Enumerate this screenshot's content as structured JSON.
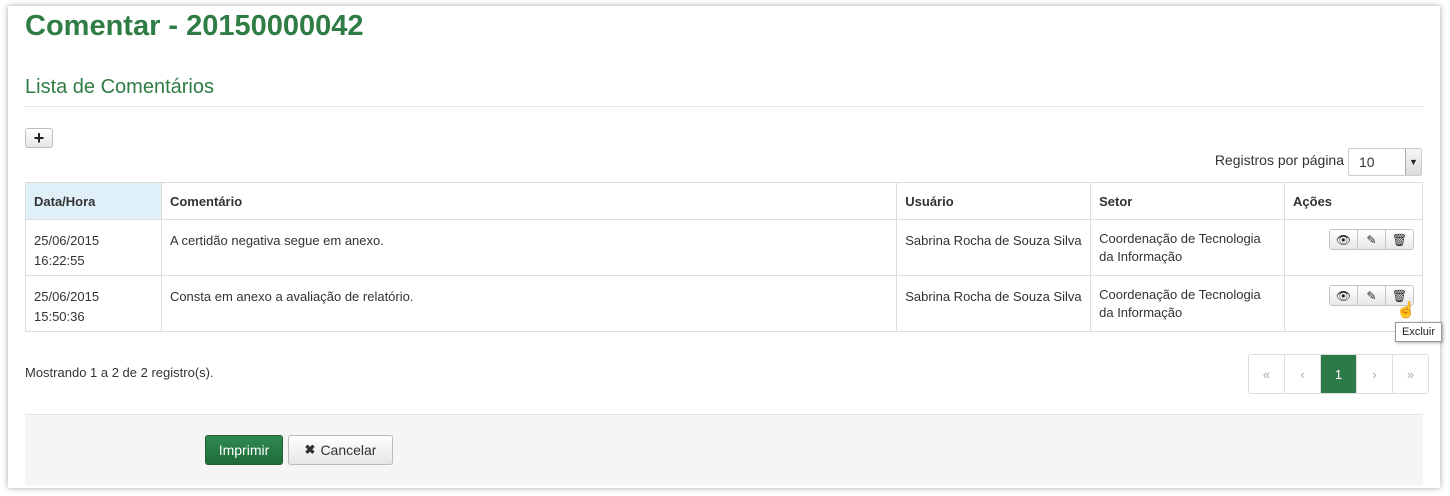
{
  "page": {
    "title": "Comentar - 20150000042",
    "subtitle": "Lista de Comentários"
  },
  "toolbar": {
    "add_icon": "+"
  },
  "pagination_size": {
    "label": "Registros por página",
    "value": "10"
  },
  "table": {
    "headers": [
      "Data/Hora",
      "Comentário",
      "Usuário",
      "Setor",
      "Ações"
    ],
    "rows": [
      {
        "datetime": "25/06/2015 16:22:55",
        "comment": "A certidão negativa segue em anexo.",
        "user": "Sabrina Rocha de Souza Silva",
        "sector_line1": "Coordenação de Tecnologia",
        "sector_line2": "da Informação"
      },
      {
        "datetime": "25/06/2015 15:50:36",
        "comment": "Consta em anexo a avaliação de relatório.",
        "user": "Sabrina Rocha de Souza Silva",
        "sector_line1": "Coordenação de Tecnologia",
        "sector_line2": "da Informação"
      }
    ]
  },
  "tooltip": "Excluir",
  "footer_info": "Mostrando 1 a 2 de 2 registro(s).",
  "pager": {
    "first": "«",
    "prev": "‹",
    "current": "1",
    "next": "›",
    "last": "»"
  },
  "buttons": {
    "print": "Imprimir",
    "cancel": "Cancelar",
    "cancel_icon": "✖"
  },
  "colors": {
    "accent": "#2f7d45",
    "active_page": "#2b7a47",
    "sorted_header": "#dff0f8"
  }
}
